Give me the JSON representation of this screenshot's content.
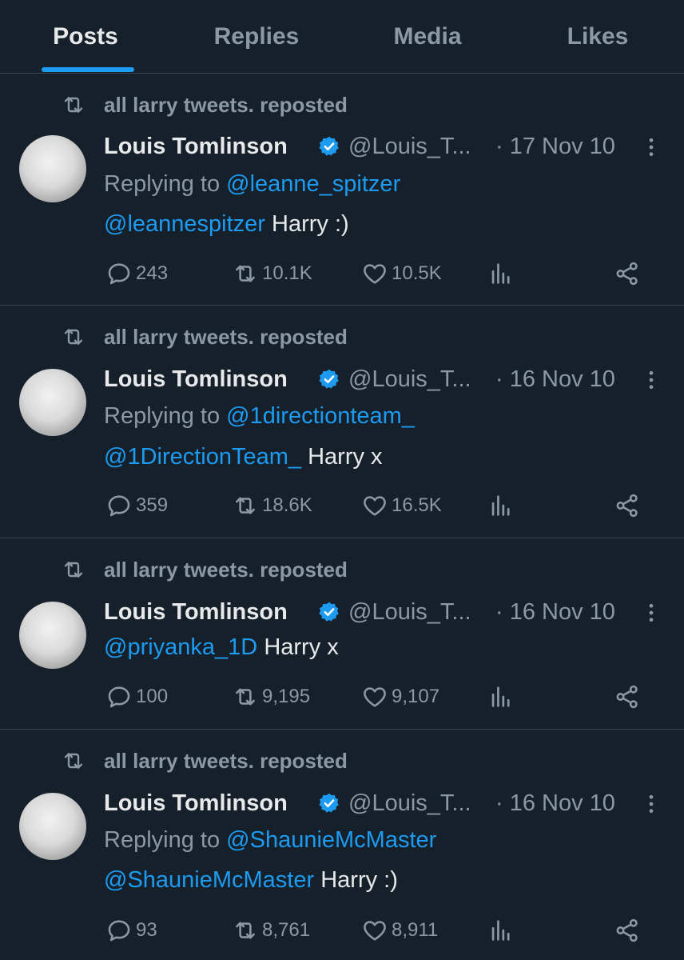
{
  "tabs": [
    {
      "label": "Posts",
      "active": true
    },
    {
      "label": "Replies",
      "active": false
    },
    {
      "label": "Media",
      "active": false
    },
    {
      "label": "Likes",
      "active": false
    }
  ],
  "colors": {
    "background": "#15202b",
    "accent": "#1d9bf0",
    "muted": "#8b98a5",
    "text": "#e7e9ea"
  },
  "tweets": [
    {
      "repost_label": "all larry tweets. reposted",
      "name": "Louis Tomlinson",
      "handle": "@Louis_T...",
      "date": "· 17 Nov 10",
      "replying_prefix": "Replying to ",
      "replying_to": "@leanne_spitzer",
      "mention": "@leannespitzer",
      "text": " Harry :)",
      "replies": "243",
      "reposts": "10.1K",
      "likes": "10.5K"
    },
    {
      "repost_label": "all larry tweets. reposted",
      "name": "Louis Tomlinson",
      "handle": "@Louis_T...",
      "date": "· 16 Nov 10",
      "replying_prefix": "Replying to ",
      "replying_to": "@1directionteam_",
      "mention": "@1DirectionTeam_",
      "text": " Harry x",
      "replies": "359",
      "reposts": "18.6K",
      "likes": "16.5K"
    },
    {
      "repost_label": "all larry tweets. reposted",
      "name": "Louis Tomlinson",
      "handle": "@Louis_T...",
      "date": "· 16 Nov 10",
      "mention": "@priyanka_1D",
      "text": " Harry x",
      "replies": "100",
      "reposts": "9,195",
      "likes": "9,107"
    },
    {
      "repost_label": "all larry tweets. reposted",
      "name": "Louis Tomlinson",
      "handle": "@Louis_T...",
      "date": "· 16 Nov 10",
      "replying_prefix": "Replying to ",
      "replying_to": "@ShaunieMcMaster",
      "mention": "@ShaunieMcMaster",
      "text": " Harry :)",
      "replies": "93",
      "reposts": "8,761",
      "likes": "8,911"
    }
  ]
}
